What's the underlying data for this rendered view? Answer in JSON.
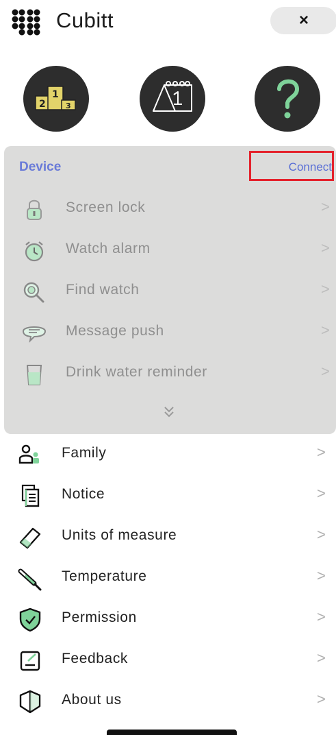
{
  "header": {
    "app_title": "Cubitt",
    "close_label": "×"
  },
  "shortcuts": [
    {
      "name": "ranking-icon"
    },
    {
      "name": "calendar-icon"
    },
    {
      "name": "help-icon"
    }
  ],
  "device": {
    "title": "Device",
    "connect_label": "Connect",
    "items": [
      {
        "label": "Screen lock",
        "icon": "lock-icon"
      },
      {
        "label": "Watch alarm",
        "icon": "alarm-clock-icon"
      },
      {
        "label": "Find watch",
        "icon": "magnifier-icon"
      },
      {
        "label": "Message push",
        "icon": "chat-bubble-icon"
      },
      {
        "label": "Drink water reminder",
        "icon": "water-cup-icon"
      }
    ],
    "expand_icon": "double-chevron-down-icon"
  },
  "menu": {
    "items": [
      {
        "label": "Family",
        "icon": "family-icon"
      },
      {
        "label": "Notice",
        "icon": "document-icon"
      },
      {
        "label": "Units of measure",
        "icon": "ruler-icon"
      },
      {
        "label": "Temperature",
        "icon": "thermometer-icon"
      },
      {
        "label": "Permission",
        "icon": "shield-check-icon"
      },
      {
        "label": "Feedback",
        "icon": "edit-icon"
      },
      {
        "label": "About us",
        "icon": "info-shield-icon"
      }
    ]
  },
  "chevron": ">",
  "colors": {
    "accent": "#6a7bd8",
    "highlight_border": "#e4222c",
    "icon_green": "#7fd39a"
  }
}
